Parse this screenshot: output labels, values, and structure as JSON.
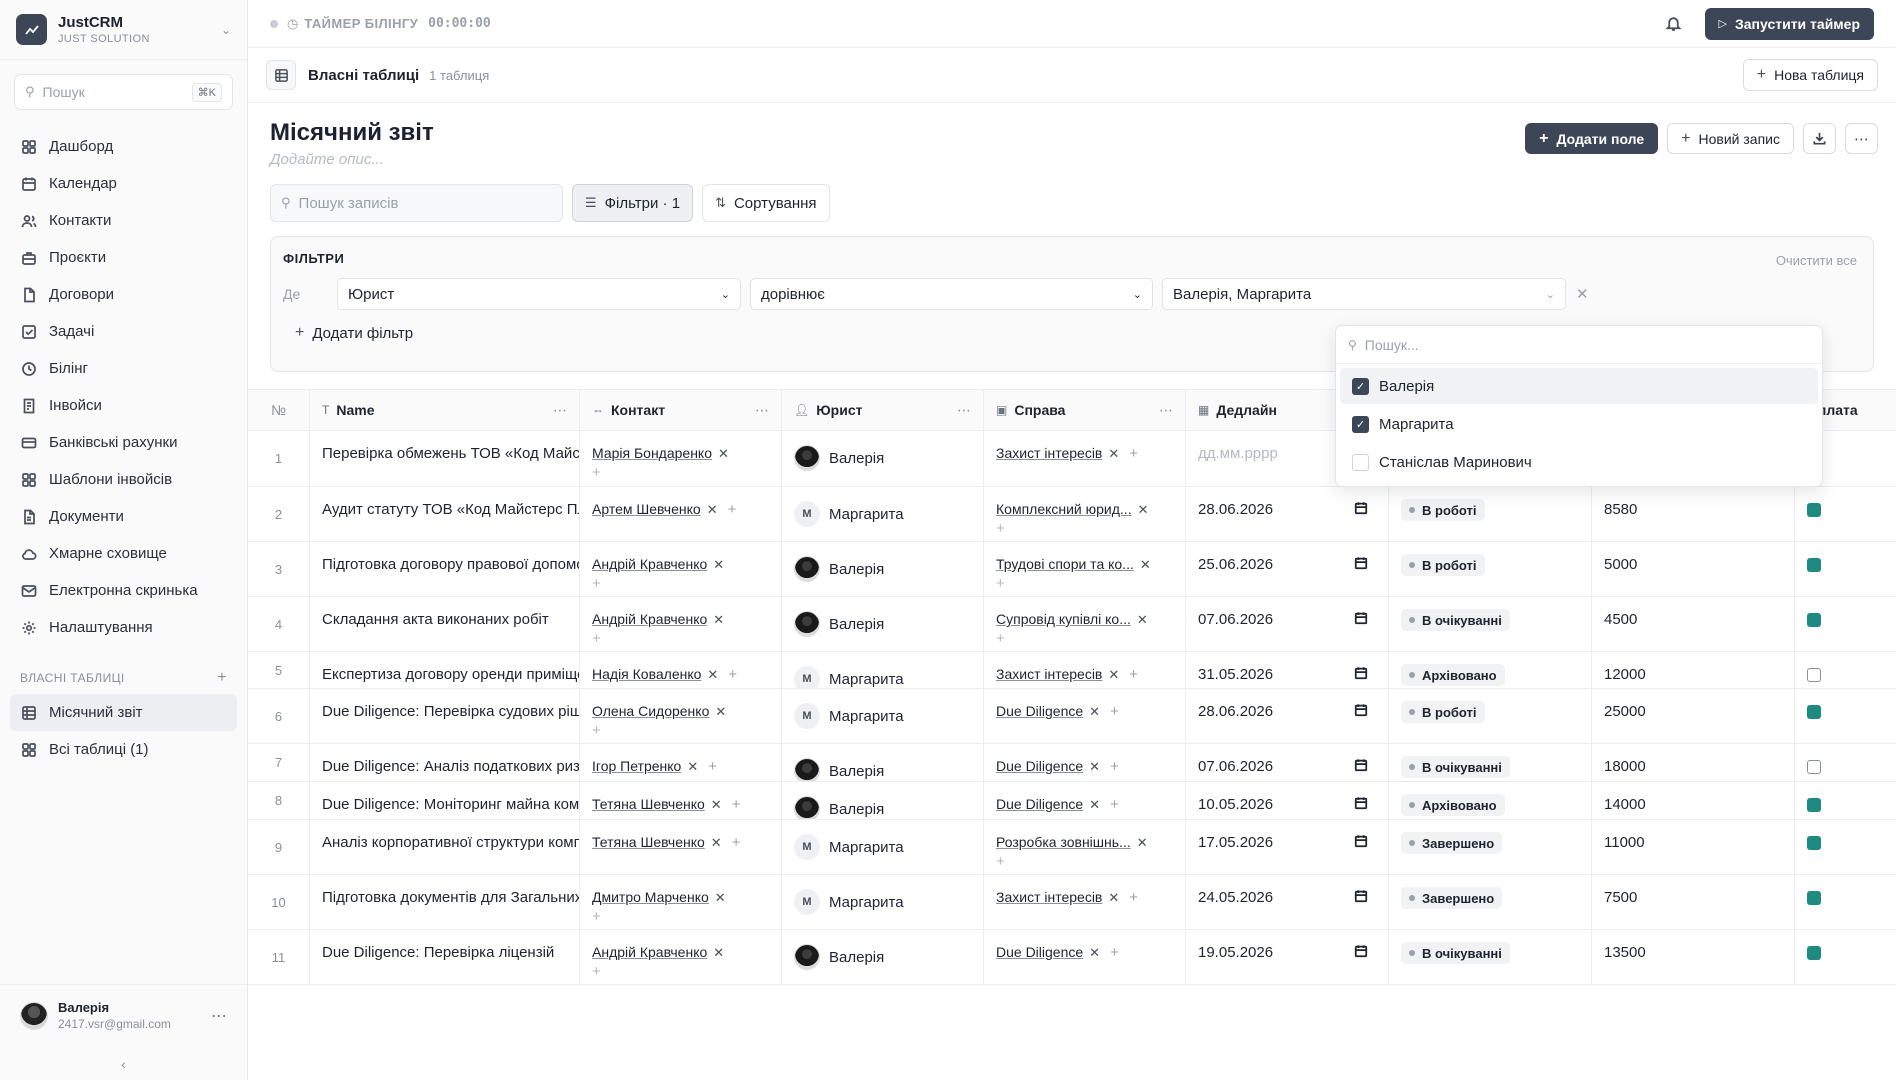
{
  "brand": {
    "name": "JustCRM",
    "sub": "JUST SOLUTION"
  },
  "sidebar": {
    "search_placeholder": "Пошук",
    "search_shortcut": "⌘K",
    "items": [
      {
        "label": "Дашборд",
        "icon": "dashboard-icon"
      },
      {
        "label": "Календар",
        "icon": "calendar-icon"
      },
      {
        "label": "Контакти",
        "icon": "contacts-icon"
      },
      {
        "label": "Проєкти",
        "icon": "briefcase-icon"
      },
      {
        "label": "Договори",
        "icon": "document-icon"
      },
      {
        "label": "Задачі",
        "icon": "checkbox-icon"
      },
      {
        "label": "Білінг",
        "icon": "clock-icon"
      },
      {
        "label": "Інвойси",
        "icon": "invoice-icon"
      },
      {
        "label": "Банківські рахунки",
        "icon": "bank-card-icon"
      },
      {
        "label": "Шаблони інвойсів",
        "icon": "template-icon"
      },
      {
        "label": "Документи",
        "icon": "file-icon"
      },
      {
        "label": "Хмарне сховище",
        "icon": "cloud-icon"
      },
      {
        "label": "Електронна скринька",
        "icon": "mail-icon"
      },
      {
        "label": "Налаштування",
        "icon": "gear-icon"
      }
    ],
    "section_title": "ВЛАСНІ ТАБЛИЦІ",
    "tables": [
      {
        "label": "Місячний звіт"
      },
      {
        "label": "Всі таблиці (1)"
      }
    ],
    "user": {
      "name": "Валерія",
      "email": "2417.vsr@gmail.com"
    }
  },
  "topbar": {
    "timer_label": "ТАЙМЕР БІЛІНГУ",
    "timer_value": "00:00:00",
    "start_timer": "Запустити таймер"
  },
  "subbar": {
    "title": "Власні таблиці",
    "count": "1 таблиця",
    "new_table": "Нова таблиця"
  },
  "page": {
    "title": "Місячний звіт",
    "description_placeholder": "Додайте опис...",
    "add_field": "Додати поле",
    "new_record": "Новий запис",
    "search_placeholder": "Пошук записів",
    "filters_btn": "Фільтри · 1",
    "sort_btn": "Сортування"
  },
  "filters": {
    "title": "ФІЛЬТРИ",
    "clear_all": "Очистити все",
    "where": "Де",
    "field": "Юрист",
    "operator": "дорівнює",
    "value": "Валерія, Маргарита",
    "add_filter": "Додати фільтр",
    "dropdown": {
      "search_placeholder": "Пошук...",
      "options": [
        {
          "label": "Валерія",
          "checked": true
        },
        {
          "label": "Маргарита",
          "checked": true
        },
        {
          "label": "Станіслав Маринович",
          "checked": false
        }
      ]
    }
  },
  "table": {
    "headers": {
      "num": "№",
      "name": "Name",
      "contact": "Контакт",
      "lawyer": "Юрист",
      "case": "Справа",
      "deadline": "Дедлайн",
      "payment": "Оплата"
    },
    "rows": [
      {
        "num": "1",
        "name": "Перевірка обмежень ТОВ «Код Майстерс Плюс»",
        "contact": "Марія Бондаренко",
        "lawyer": "Валерія",
        "lawyer_photo": true,
        "case": "Захист інтересів",
        "deadline": "дд.мм.рррр",
        "deadline_placeholder": true,
        "status": "",
        "amount": "",
        "paid": true,
        "h": 56,
        "contact_wrap": true,
        "case_wrap": false
      },
      {
        "num": "2",
        "name": "Аудит статуту ТОВ «Код Майстерс Плюс»",
        "contact": "Артем Шевченко",
        "lawyer": "Маргарита",
        "lawyer_photo": false,
        "case": "Комплексний юрид...",
        "deadline": "28.06.2026",
        "status": "В роботі",
        "amount": "8580",
        "paid": true,
        "h": 55,
        "contact_wrap": false,
        "case_wrap": true
      },
      {
        "num": "3",
        "name": "Підготовка договору правової допомоги",
        "contact": "Андрій Кравченко",
        "lawyer": "Валерія",
        "lawyer_photo": true,
        "case": "Трудові спори та ко...",
        "deadline": "25.06.2026",
        "status": "В роботі",
        "amount": "5000",
        "paid": true,
        "h": 55,
        "contact_wrap": true,
        "case_wrap": true
      },
      {
        "num": "4",
        "name": "Складання акта виконаних робіт",
        "contact": "Андрій Кравченко",
        "lawyer": "Валерія",
        "lawyer_photo": true,
        "case": "Супровід купівлі ко...",
        "deadline": "07.06.2026",
        "status": "В очікуванні",
        "amount": "4500",
        "paid": true,
        "h": 55,
        "contact_wrap": true,
        "case_wrap": true
      },
      {
        "num": "5",
        "name": "Експертиза договору оренди приміщення",
        "contact": "Надія Коваленко",
        "lawyer": "Маргарита",
        "lawyer_photo": false,
        "case": "Захист інтересів",
        "deadline": "31.05.2026",
        "status": "Архівовано",
        "amount": "12000",
        "paid": false,
        "h": 37,
        "contact_wrap": false,
        "case_wrap": false
      },
      {
        "num": "6",
        "name": "Due Diligence: Перевірка судових рішень",
        "contact": "Олена Сидоренко",
        "lawyer": "Маргарита",
        "lawyer_photo": false,
        "case": "Due Diligence",
        "deadline": "28.06.2026",
        "status": "В роботі",
        "amount": "25000",
        "paid": true,
        "h": 55,
        "contact_wrap": true,
        "case_wrap": false
      },
      {
        "num": "7",
        "name": "Due Diligence: Аналіз податкових ризиків",
        "contact": "Ігор Петренко",
        "lawyer": "Валерія",
        "lawyer_photo": true,
        "case": "Due Diligence",
        "deadline": "07.06.2026",
        "status": "В очікуванні",
        "amount": "18000",
        "paid": false,
        "h": 38,
        "contact_wrap": false,
        "case_wrap": false
      },
      {
        "num": "8",
        "name": "Due Diligence: Моніторинг майна компанії",
        "contact": "Тетяна Шевченко",
        "lawyer": "Валерія",
        "lawyer_photo": true,
        "case": "Due Diligence",
        "deadline": "10.05.2026",
        "status": "Архівовано",
        "amount": "14000",
        "paid": true,
        "h": 38,
        "contact_wrap": false,
        "case_wrap": false
      },
      {
        "num": "9",
        "name": "Аналіз корпоративної структури компанії",
        "contact": "Тетяна Шевченко",
        "lawyer": "Маргарита",
        "lawyer_photo": false,
        "case": "Розробка зовнішнь...",
        "deadline": "17.05.2026",
        "status": "Завершено",
        "amount": "11000",
        "paid": true,
        "h": 55,
        "contact_wrap": false,
        "case_wrap": true
      },
      {
        "num": "10",
        "name": "Підготовка документів для Загальних зборів",
        "contact": "Дмитро Марченко",
        "lawyer": "Маргарита",
        "lawyer_photo": false,
        "case": "Захист інтересів",
        "deadline": "24.05.2026",
        "status": "Завершено",
        "amount": "7500",
        "paid": true,
        "h": 55,
        "contact_wrap": true,
        "case_wrap": false
      },
      {
        "num": "11",
        "name": "Due Diligence: Перевірка ліцензій",
        "contact": "Андрій Кравченко",
        "lawyer": "Валерія",
        "lawyer_photo": true,
        "case": "Due Diligence",
        "deadline": "19.05.2026",
        "status": "В очікуванні",
        "amount": "13500",
        "paid": true,
        "h": 55,
        "contact_wrap": true,
        "case_wrap": false
      }
    ]
  },
  "colors": {
    "primary": "#3d4656",
    "checkbox_on": "#1f8a80"
  }
}
